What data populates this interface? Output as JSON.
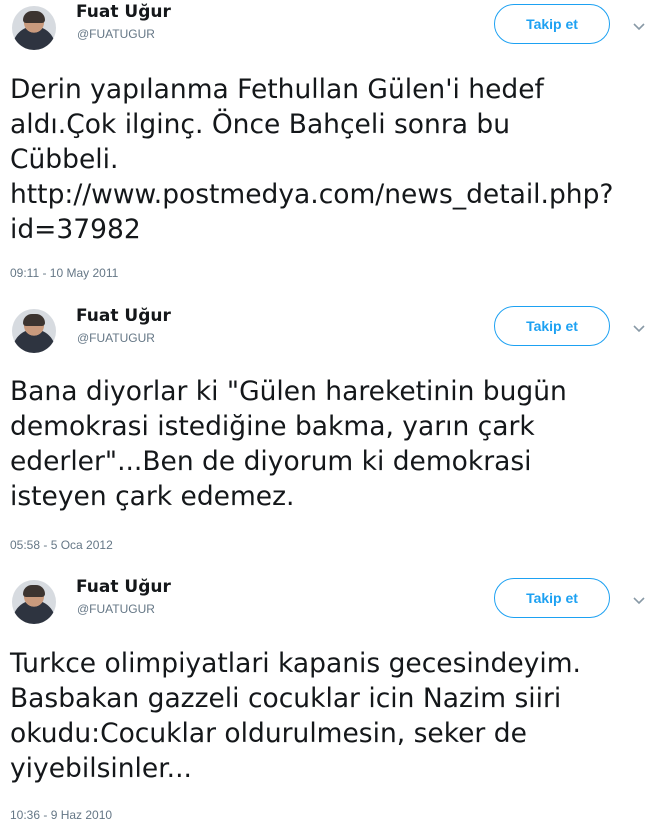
{
  "tweets": [
    {
      "author_name": "Fuat Uğur",
      "author_handle": "@FUATUGUR",
      "follow_label": "Takip et",
      "text": "Derin yapılanma Fethullan Gülen'i hedef\naldı.Çok ilginç. Önce Bahçeli sonra bu\nCübbeli.\nhttp://www.postmedya.com/news_detail.php?\nid=37982",
      "timestamp": "09:11 - 10 May 2011"
    },
    {
      "author_name": "Fuat Uğur",
      "author_handle": "@FUATUGUR",
      "follow_label": "Takip et",
      "text": "Bana diyorlar ki \"Gülen hareketinin bugün\ndemokrasi istediğine bakma, yarın çark\nederler\"...Ben de diyorum ki demokrasi\nisteyen çark edemez.",
      "timestamp": "05:58 - 5 Oca 2012"
    },
    {
      "author_name": "Fuat Uğur",
      "author_handle": "@FUATUGUR",
      "follow_label": "Takip et",
      "text": "Turkce olimpiyatlari kapanis gecesindeyim.\nBasbakan gazzeli cocuklar icin Nazim siiri\nokudu:Cocuklar oldurulmesin, seker de\nyiyebilsinler...",
      "timestamp": "10:36 - 9 Haz 2010"
    }
  ],
  "icons": {
    "avatar": "profile-photo",
    "chevron": "chevron-down-icon"
  },
  "colors": {
    "accent": "#1da1f2",
    "text": "#14171a",
    "muted": "#657786"
  }
}
